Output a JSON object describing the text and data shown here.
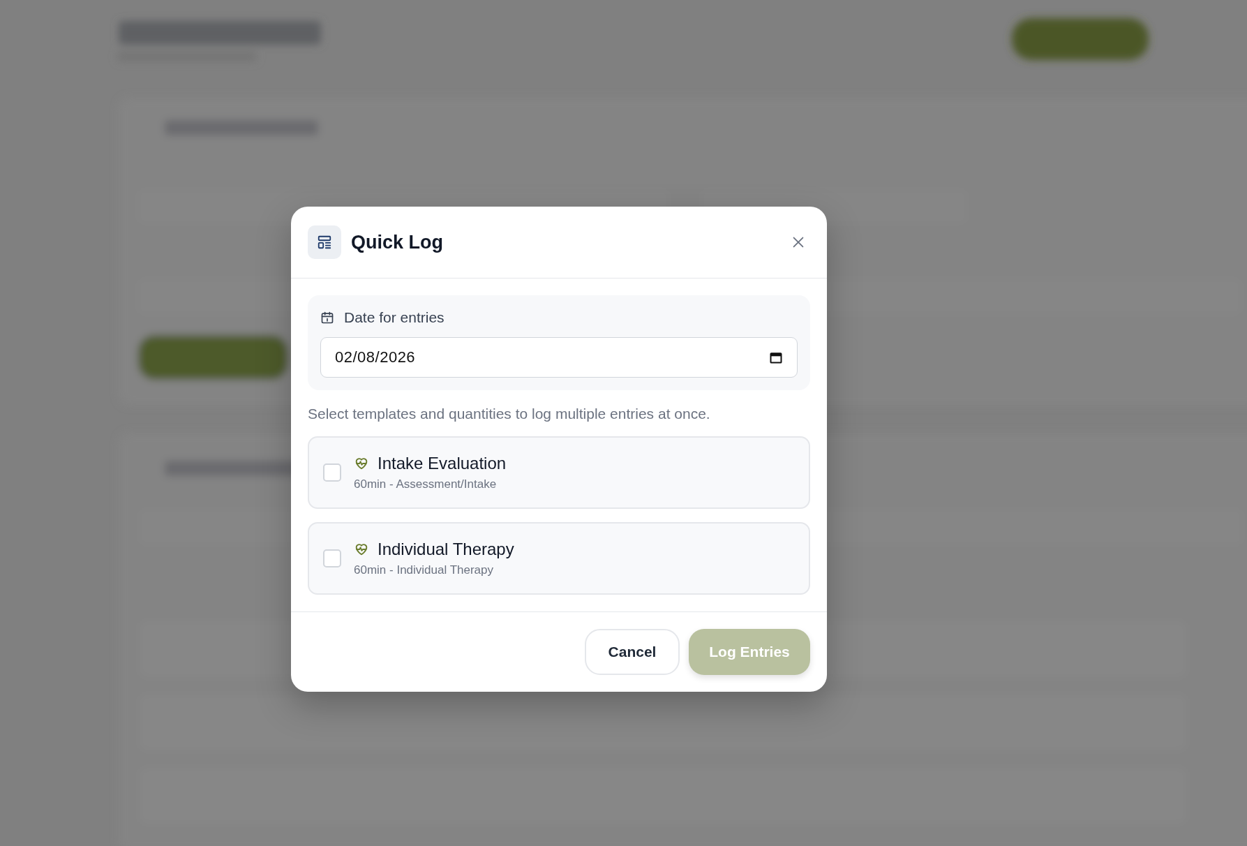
{
  "modal": {
    "title": "Quick Log",
    "date_section": {
      "label": "Date for entries",
      "value": "02/08/2026"
    },
    "instructions": "Select templates and quantities to log multiple entries at once.",
    "templates": [
      {
        "name": "Intake Evaluation",
        "detail": "60min - Assessment/Intake",
        "checked": false
      },
      {
        "name": "Individual Therapy",
        "detail": "60min - Individual Therapy",
        "checked": false
      }
    ],
    "buttons": [
      {
        "label": "Cancel",
        "kind": "secondary",
        "disabled": false
      },
      {
        "label": "Log Entries",
        "kind": "primary",
        "disabled": true
      }
    ]
  }
}
